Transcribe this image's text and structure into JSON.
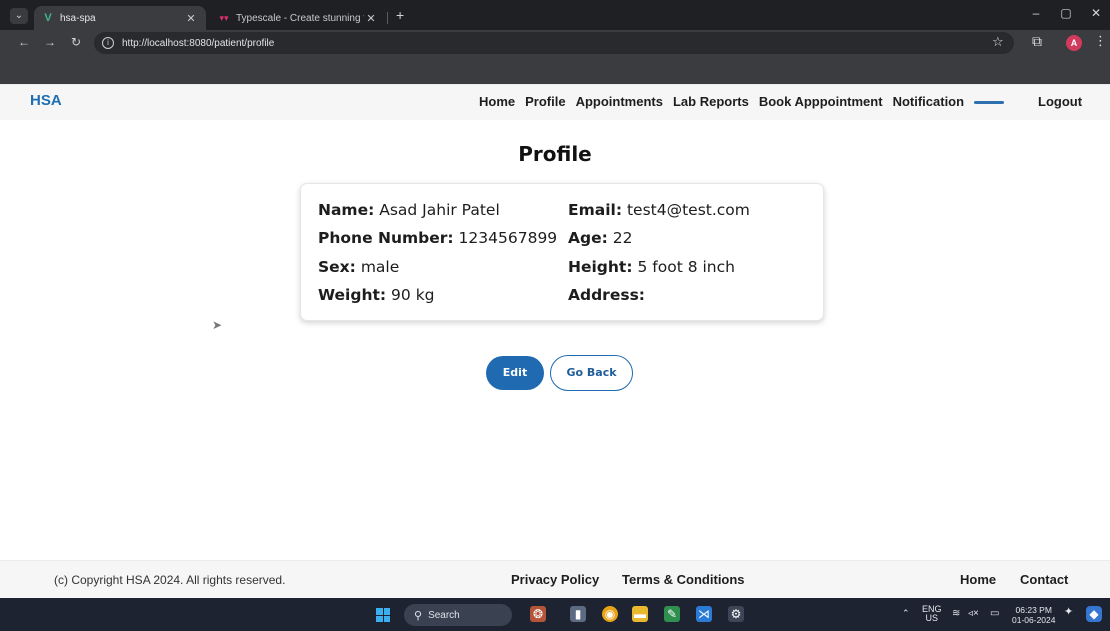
{
  "browser": {
    "tabs": [
      {
        "title": "hsa-spa",
        "active": true
      },
      {
        "title": "Typescale - Create stunning typ",
        "active": false
      }
    ],
    "url": "http://localhost:8080/patient/profile",
    "profile_initial": "A"
  },
  "navbar": {
    "brand": "HSA",
    "links": [
      "Home",
      "Profile",
      "Appointments",
      "Lab Reports",
      "Book Apppointment",
      "Notification"
    ],
    "logout": "Logout"
  },
  "profile": {
    "title": "Profile",
    "fields": [
      {
        "label": "Name:",
        "value": "Asad Jahir Patel"
      },
      {
        "label": "Email:",
        "value": "test4@test.com"
      },
      {
        "label": "Phone Number:",
        "value": "1234567899"
      },
      {
        "label": "Age:",
        "value": "22"
      },
      {
        "label": "Sex:",
        "value": "male"
      },
      {
        "label": "Height:",
        "value": "5 foot 8 inch"
      },
      {
        "label": "Weight:",
        "value": "90 kg"
      },
      {
        "label": "Address:",
        "value": ""
      }
    ],
    "edit_label": "Edit",
    "back_label": "Go Back"
  },
  "footer": {
    "copyright": "(c) Copyright HSA 2024. All rights reserved.",
    "privacy": "Privacy Policy",
    "terms": "Terms & Conditions",
    "home": "Home",
    "contact": "Contact"
  },
  "taskbar": {
    "search_placeholder": "Search",
    "lang_top": "ENG",
    "lang_bottom": "US",
    "time": "06:23 PM",
    "date": "01-06-2024"
  },
  "colors": {
    "brand": "#1f6fb0",
    "primary_button": "#1f6ab0",
    "nav_indicator": "#2e6fb0"
  }
}
